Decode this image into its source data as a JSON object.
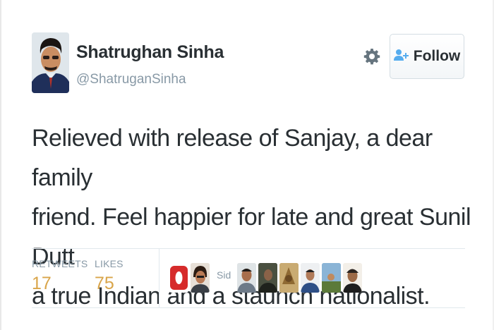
{
  "author": {
    "name": "Shatrughan Sinha",
    "handle": "@ShatruganSinha"
  },
  "icons": {
    "settings": "gear-icon",
    "follow": "add-person-icon"
  },
  "follow_button": {
    "label": "Follow"
  },
  "tweet": {
    "lines": [
      "Relieved with release of Sanjay, a dear family",
      "friend. Feel happier for late and great Sunil Dutt",
      "a true Indian and a staunch nationalist."
    ]
  },
  "stats": {
    "retweets_label": "RETWEETS",
    "retweets_count": "17",
    "likes_label": "LIKES",
    "likes_count": "75"
  },
  "likers_partial_label": "Sid",
  "colors": {
    "text": "#292f33",
    "muted": "#8899a6",
    "count": "#d9a54a",
    "divider": "#e1e8ed"
  }
}
